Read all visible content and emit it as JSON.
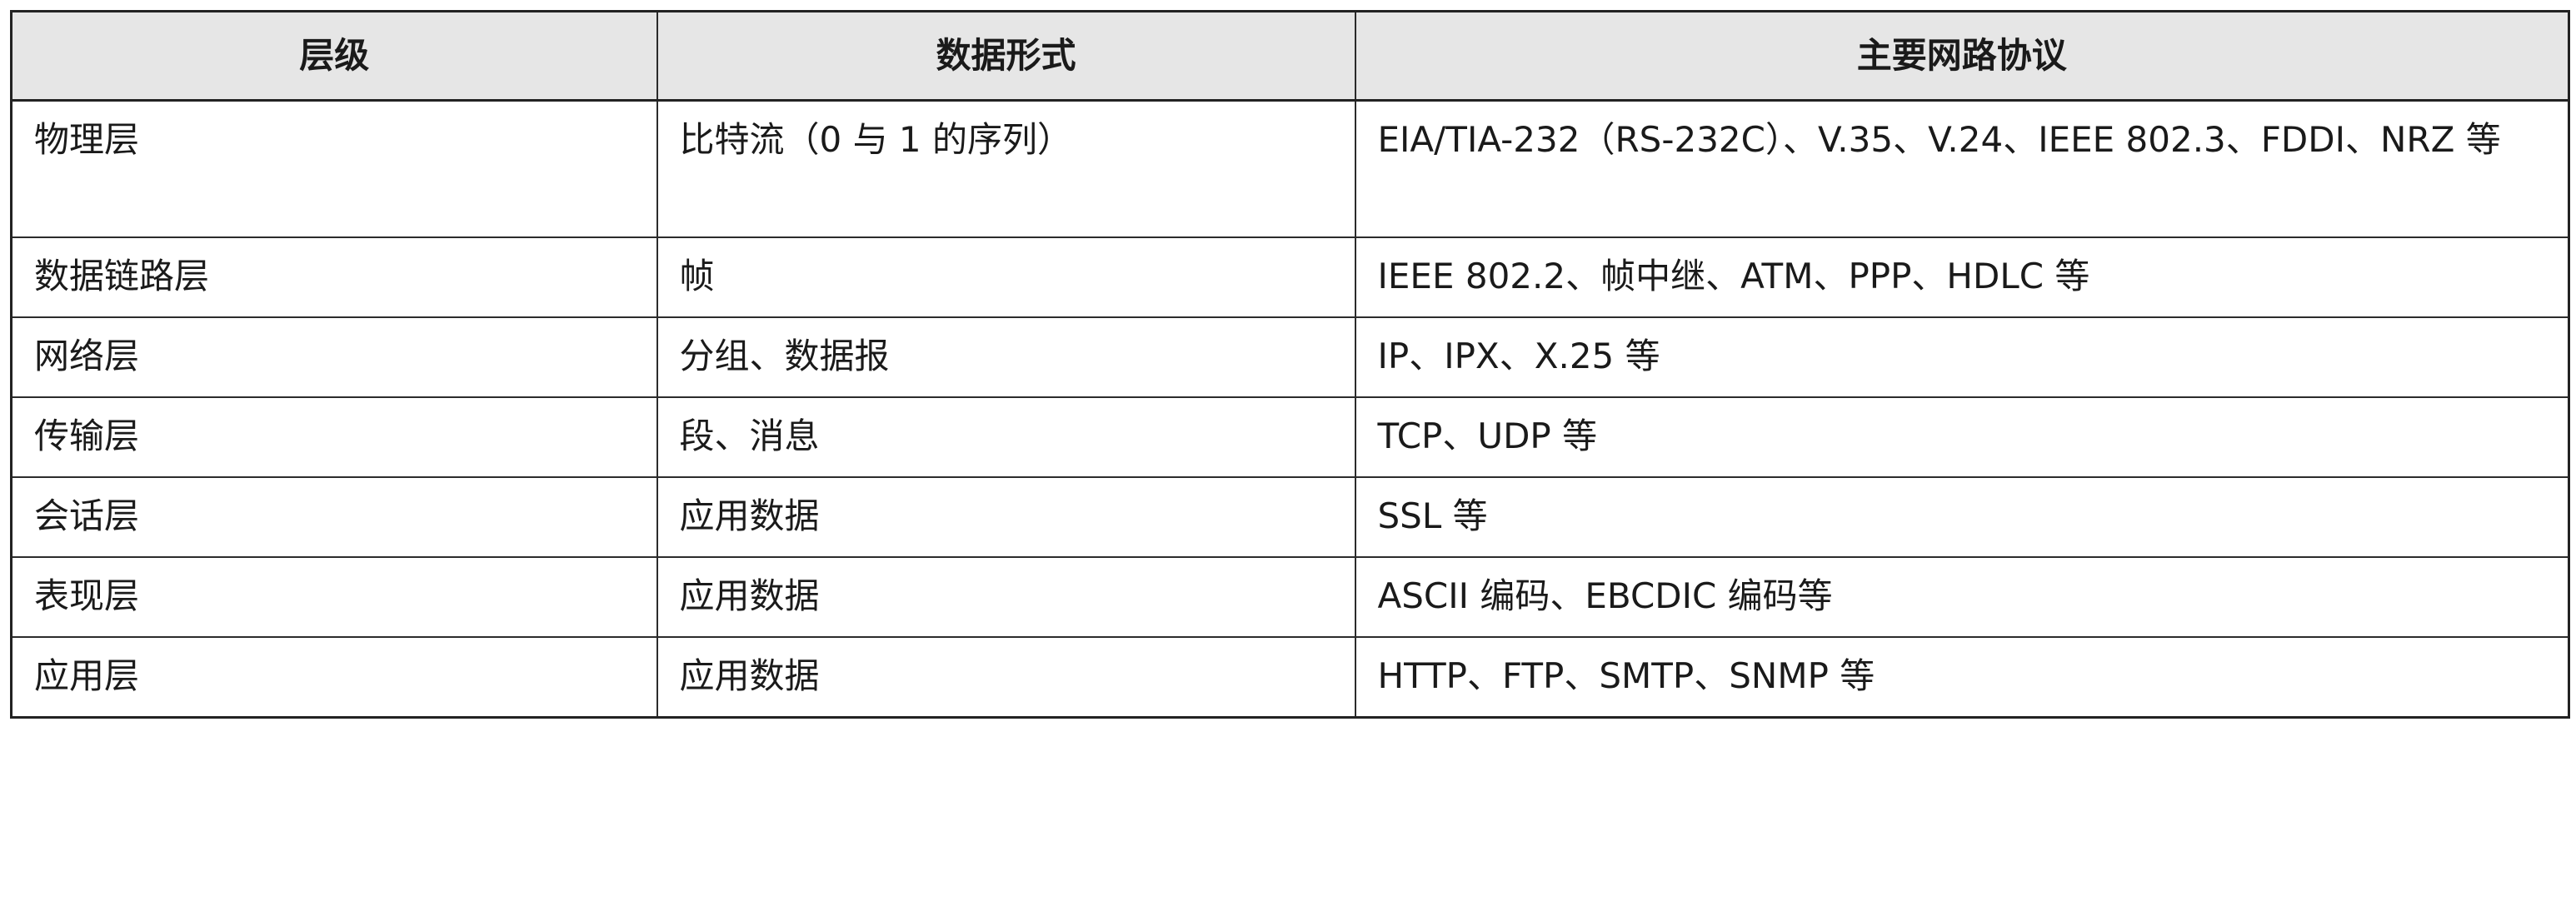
{
  "table": {
    "headers": [
      "层级",
      "数据形式",
      "主要网路协议"
    ],
    "rows": [
      {
        "layer": "物理层",
        "data_form": "比特流（0 与 1 的序列）",
        "protocols": "EIA/TIA-232（RS-232C）、V.35、V.24、IEEE 802.3、FDDI、NRZ 等"
      },
      {
        "layer": "数据链路层",
        "data_form": "帧",
        "protocols": "IEEE 802.2、帧中继、ATM、PPP、HDLC 等"
      },
      {
        "layer": "网络层",
        "data_form": "分组、数据报",
        "protocols": "IP、IPX、X.25 等"
      },
      {
        "layer": "传输层",
        "data_form": "段、消息",
        "protocols": "TCP、UDP 等"
      },
      {
        "layer": "会话层",
        "data_form": "应用数据",
        "protocols": "SSL 等"
      },
      {
        "layer": "表现层",
        "data_form": "应用数据",
        "protocols": "ASCII 编码、EBCDIC 编码等"
      },
      {
        "layer": "应用层",
        "data_form": "应用数据",
        "protocols": "HTTP、FTP、SMTP、SNMP 等"
      }
    ]
  }
}
